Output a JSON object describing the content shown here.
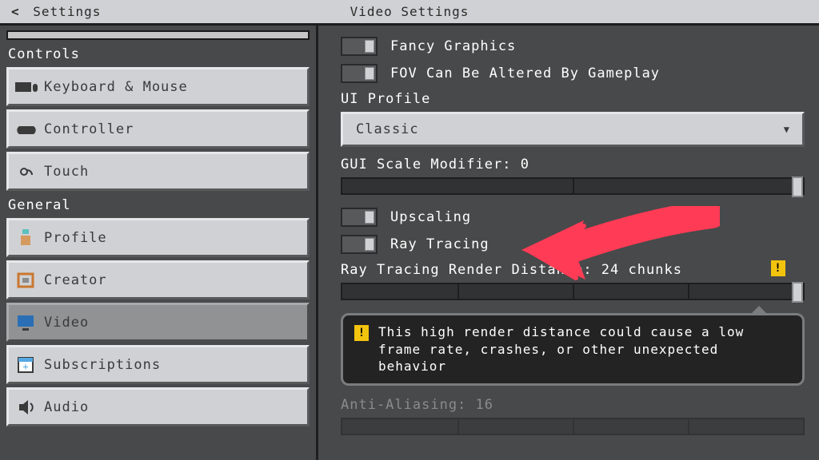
{
  "header": {
    "back_label": "Settings",
    "title": "Video Settings"
  },
  "sidebar": {
    "controls_header": "Controls",
    "general_header": "General",
    "items": [
      {
        "label": "Keyboard & Mouse",
        "active": false
      },
      {
        "label": "Controller",
        "active": false
      },
      {
        "label": "Touch",
        "active": false
      },
      {
        "label": "Profile",
        "active": false
      },
      {
        "label": "Creator",
        "active": false
      },
      {
        "label": "Video",
        "active": true
      },
      {
        "label": "Subscriptions",
        "active": false
      },
      {
        "label": "Audio",
        "active": false
      }
    ]
  },
  "main": {
    "fancy_graphics": {
      "label": "Fancy Graphics",
      "on": true
    },
    "fov_gameplay": {
      "label": "FOV Can Be Altered By Gameplay",
      "on": true
    },
    "ui_profile": {
      "label": "UI Profile",
      "value": "Classic"
    },
    "gui_scale": {
      "label": "GUI Scale Modifier: 0",
      "value": 0
    },
    "upscaling": {
      "label": "Upscaling",
      "on": true
    },
    "ray_tracing": {
      "label": "Ray Tracing",
      "on": true
    },
    "rt_distance": {
      "label": "Ray Tracing Render Distance: 24 chunks",
      "value": 24
    },
    "warning_text": "This high render distance could cause a low frame rate, crashes, or other unexpected behavior",
    "anti_aliasing": {
      "label": "Anti-Aliasing: 16",
      "value": 16
    }
  },
  "colors": {
    "accent_arrow": "#ff3b55"
  }
}
